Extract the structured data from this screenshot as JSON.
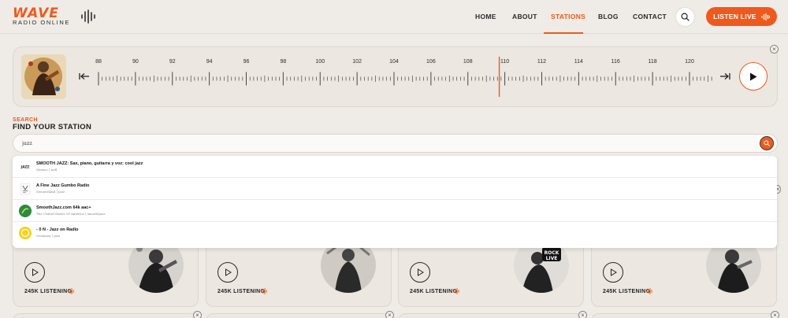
{
  "brand": {
    "name": "WAVE",
    "tagline": "RADIO ONLINE",
    "accent": "#ee5a1c"
  },
  "nav": {
    "items": [
      {
        "label": "HOME",
        "active": false
      },
      {
        "label": "ABOUT",
        "active": false
      },
      {
        "label": "STATIONS",
        "active": true
      },
      {
        "label": "BLOG",
        "active": false
      },
      {
        "label": "CONTACT",
        "active": false
      }
    ],
    "search_icon": "search-icon",
    "listen_live_label": "LISTEN LIVE"
  },
  "tuner": {
    "frequencies": [
      "88",
      "90",
      "92",
      "94",
      "96",
      "98",
      "100",
      "102",
      "104",
      "106",
      "108",
      "110",
      "112",
      "114",
      "116",
      "118",
      "120"
    ],
    "current_frequency": 109.7,
    "prev_icon": "arrow-left-icon",
    "next_icon": "arrow-right-icon",
    "play_icon": "play-icon"
  },
  "search": {
    "label": "SEARCH",
    "title": "FIND YOUR STATION",
    "query": "jazz"
  },
  "results": [
    {
      "name": "SMOOTH JAZZ: Sax, piano, guitarra y voz: cool jazz",
      "meta": "Mexico | null"
    },
    {
      "name": "A Fine Jazz Gumbo Radio",
      "meta": "Switzerland | jazz"
    },
    {
      "name": "SmoothJazz.com 64k aac+",
      "meta": "The United States Of America | smoothjazz"
    },
    {
      "name": "- 0 N - Jazz on Radio",
      "meta": "Germany | jazz"
    }
  ],
  "cards": [
    {
      "listeners": "245K LISTENING"
    },
    {
      "listeners": "245K LISTENING"
    },
    {
      "listeners": "245K LISTENING"
    },
    {
      "listeners": "245K LISTENING"
    }
  ]
}
